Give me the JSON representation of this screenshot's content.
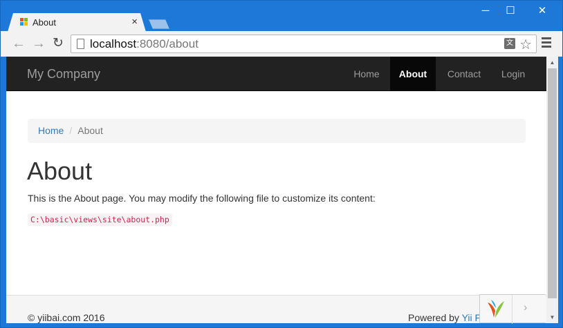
{
  "browser": {
    "tab_title": "About",
    "tab_close": "×",
    "url_host": "localhost",
    "url_rest": ":8080/about",
    "translate_glyph": "文",
    "window_minimize": "─",
    "window_maximize": "☐",
    "window_close": "✕",
    "back_glyph": "←",
    "forward_glyph": "→",
    "reload_glyph": "↻",
    "star_glyph": "☆"
  },
  "navbar": {
    "brand": "My Company",
    "items": [
      {
        "label": "Home"
      },
      {
        "label": "About",
        "active": true
      },
      {
        "label": "Contact"
      },
      {
        "label": "Login"
      }
    ]
  },
  "breadcrumb": {
    "home": "Home",
    "separator": "/",
    "current": "About"
  },
  "main": {
    "title": "About",
    "text": "This is the About page. You may modify the following file to customize its content:",
    "code": "C:\\basic\\views\\site\\about.php"
  },
  "footer": {
    "copyright": "© yiibai.com 2016",
    "powered_prefix": "Powered by",
    "powered_link": "Yii F"
  },
  "debug_widget": {
    "toggle_glyph": "›"
  },
  "scrollbar": {
    "up_glyph": "▲",
    "down_glyph": "▼"
  },
  "colors": {
    "window_frame": "#1e78d7",
    "navbar_bg": "#222222",
    "link": "#337ab7",
    "code_text": "#c7254e"
  }
}
